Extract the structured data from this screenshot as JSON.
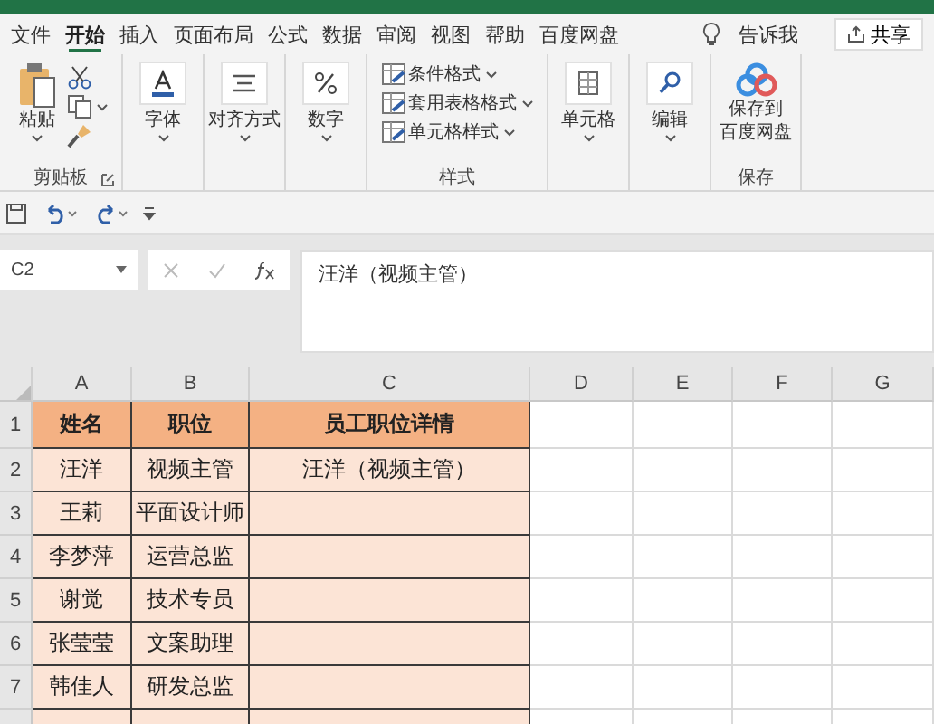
{
  "tabs": [
    {
      "label": "文件",
      "selected": false
    },
    {
      "label": "开始",
      "selected": true
    },
    {
      "label": "插入",
      "selected": false
    },
    {
      "label": "页面布局",
      "selected": false
    },
    {
      "label": "公式",
      "selected": false
    },
    {
      "label": "数据",
      "selected": false
    },
    {
      "label": "审阅",
      "selected": false
    },
    {
      "label": "视图",
      "selected": false
    },
    {
      "label": "帮助",
      "selected": false
    },
    {
      "label": "百度网盘",
      "selected": false
    }
  ],
  "tell_me": "告诉我",
  "share_button": "共享",
  "ribbon_groups": [
    {
      "kind": "clipboard",
      "button": "粘贴",
      "label": "剪贴板"
    },
    {
      "kind": "font",
      "button": "字体"
    },
    {
      "kind": "align",
      "button": "对齐方式"
    },
    {
      "kind": "number",
      "button": "数字"
    },
    {
      "kind": "list",
      "items": [
        "条件格式",
        "套用表格格式",
        "单元格样式"
      ],
      "label": "样式"
    },
    {
      "kind": "cells",
      "button": "单元格"
    },
    {
      "kind": "editing",
      "button": "编辑"
    },
    {
      "kind": "save",
      "button_lines": [
        "保存到",
        "百度网盘"
      ],
      "label": "保存"
    }
  ],
  "formula_bar": {
    "name_box": "C2",
    "formula": "汪洋（视频主管）"
  },
  "sheet": {
    "columns": [
      "A",
      "B",
      "C",
      "D",
      "E",
      "F",
      "G"
    ],
    "rows": [
      {
        "header": "1",
        "kind": "heading",
        "cells": [
          "姓名",
          "职位",
          "员工职位详情"
        ]
      },
      {
        "header": "2",
        "kind": "data",
        "cells": [
          "汪洋",
          "视频主管",
          "汪洋（视频主管）"
        ]
      },
      {
        "header": "3",
        "kind": "data",
        "cells": [
          "王莉",
          "平面设计师",
          ""
        ]
      },
      {
        "header": "4",
        "kind": "data",
        "cells": [
          "李梦萍",
          "运营总监",
          ""
        ]
      },
      {
        "header": "5",
        "kind": "data",
        "cells": [
          "谢觉",
          "技术专员",
          ""
        ]
      },
      {
        "header": "6",
        "kind": "data",
        "cells": [
          "张莹莹",
          "文案助理",
          ""
        ]
      },
      {
        "header": "7",
        "kind": "data",
        "cells": [
          "韩佳人",
          "研发总监",
          ""
        ]
      }
    ]
  }
}
